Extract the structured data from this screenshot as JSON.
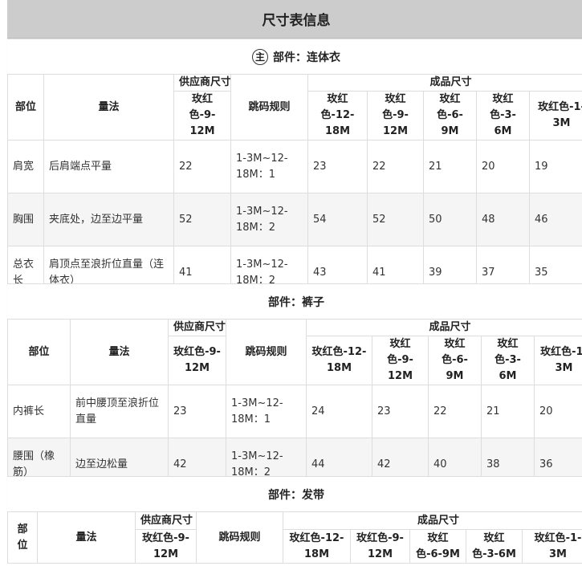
{
  "title": "尺寸表信息",
  "main_badge": "主",
  "columns": {
    "part": "部位",
    "method": "量法",
    "supplier": "供应商尺寸",
    "rule": "跳码规则",
    "finished": "成品尺寸",
    "supplier_size": "玫红色-9-12M",
    "sizes": [
      "玫红色-12-18M",
      "玫红色-9-12M",
      "玫红色-6-9M",
      "玫红色-3-6M",
      "玫红色-1-3M"
    ]
  },
  "sections": [
    {
      "title": "部件：连体衣",
      "rows": [
        {
          "part": "肩宽",
          "method": "后肩端点平量",
          "supplier": "22",
          "rule": "1-3M~12-18M：1",
          "values": [
            "23",
            "22",
            "21",
            "20",
            "19"
          ]
        },
        {
          "part": "胸围",
          "method": "夹底处，边至边平量",
          "supplier": "52",
          "rule": "1-3M~12-18M：2",
          "values": [
            "54",
            "52",
            "50",
            "48",
            "46"
          ]
        },
        {
          "part": "总衣长",
          "method": "肩顶点至浪折位直量（连体衣）",
          "supplier": "41",
          "rule": "1-3M~12-18M：2",
          "values": [
            "43",
            "41",
            "39",
            "37",
            "35"
          ]
        }
      ]
    },
    {
      "title": "部件：裤子",
      "rows": [
        {
          "part": "内裤长",
          "method": "前中腰顶至浪折位直量",
          "supplier": "23",
          "rule": "1-3M~12-18M：1",
          "values": [
            "24",
            "23",
            "22",
            "21",
            "20"
          ]
        },
        {
          "part": "腰围（橡筋）",
          "method": "边至边松量",
          "supplier": "42",
          "rule": "1-3M~12-18M：2",
          "values": [
            "44",
            "42",
            "40",
            "38",
            "36"
          ]
        }
      ]
    },
    {
      "title": "部件：发带",
      "rows": []
    }
  ]
}
